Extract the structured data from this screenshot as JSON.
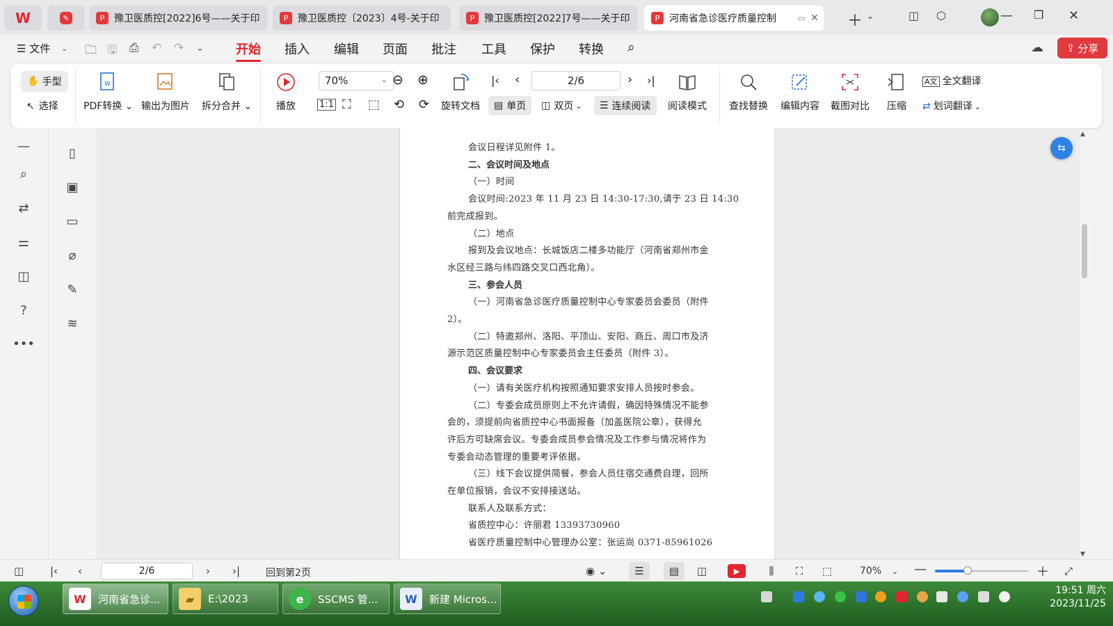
{
  "tabs": [
    {
      "title": "豫卫医质控[2022]6号——关于印",
      "active": false
    },
    {
      "title": "豫卫医质控〔2023〕4号-关于印",
      "active": false
    },
    {
      "title": "豫卫医质控[2022]7号——关于印",
      "active": false
    },
    {
      "title": "河南省急诊医疗质量控制",
      "active": true
    }
  ],
  "menubar": {
    "file": "☰ 文件",
    "items": [
      "开始",
      "插入",
      "编辑",
      "页面",
      "批注",
      "工具",
      "保护",
      "转换"
    ],
    "share": "分享"
  },
  "ribbon": {
    "hand": "手型",
    "select": "选择",
    "pdf_convert": "PDF转换",
    "export_image": "输出为图片",
    "split_merge": "拆分合并",
    "play": "播放",
    "zoom": "70%",
    "page": "2/6",
    "rotate_doc": "旋转文档",
    "single_page": "单页",
    "double_page": "双页",
    "continuous": "连续阅读",
    "read_mode": "阅读模式",
    "find_replace": "查找替换",
    "edit_content": "编辑内容",
    "screenshot_compare": "截图对比",
    "compress": "压缩",
    "full_translate": "全文翻译",
    "word_translate": "划词翻译"
  },
  "document": {
    "lines": [
      {
        "text": "会议日程详见附件 1。",
        "indent": true,
        "bold": false
      },
      {
        "text": "二、会议时间及地点",
        "indent": true,
        "bold": true
      },
      {
        "text": "（一）时间",
        "indent": true,
        "bold": false
      },
      {
        "text": "会议时间:2023 年 11 月 23 日 14:30-17:30,请于 23 日 14:30",
        "indent": true,
        "bold": false
      },
      {
        "text": "前完成报到。",
        "indent": false,
        "bold": false
      },
      {
        "text": "（二）地点",
        "indent": true,
        "bold": false
      },
      {
        "text": "报到及会议地点：长城饭店二楼多功能厅（河南省郑州市金",
        "indent": true,
        "bold": false
      },
      {
        "text": "水区经三路与纬四路交叉口西北角）。",
        "indent": false,
        "bold": false
      },
      {
        "text": "三、参会人员",
        "indent": true,
        "bold": true
      },
      {
        "text": "（一）河南省急诊医疗质量控制中心专家委员会委员（附件",
        "indent": true,
        "bold": false
      },
      {
        "text": "2）。",
        "indent": false,
        "bold": false
      },
      {
        "text": "（二）特邀郑州、洛阳、平顶山、安阳、商丘、周口市及济",
        "indent": true,
        "bold": false
      },
      {
        "text": "源示范区质量控制中心专家委员会主任委员（附件 3）。",
        "indent": false,
        "bold": false
      },
      {
        "text": "四、会议要求",
        "indent": true,
        "bold": true
      },
      {
        "text": "（一）请有关医疗机构按照通知要求安排人员按时参会。",
        "indent": true,
        "bold": false
      },
      {
        "text": "（二）专委会成员原则上不允许请假，确因特殊情况不能参",
        "indent": true,
        "bold": false
      },
      {
        "text": "会的，须提前向省质控中心书面报备（加盖医院公章），获得允",
        "indent": false,
        "bold": false
      },
      {
        "text": "许后方可缺席会议。专委会成员参会情况及工作参与情况将作为",
        "indent": false,
        "bold": false
      },
      {
        "text": "专委会动态管理的重要考评依据。",
        "indent": false,
        "bold": false
      },
      {
        "text": "（三）线下会议提供简餐，参会人员住宿交通费自理，回所",
        "indent": true,
        "bold": false
      },
      {
        "text": "在单位报销，会议不安排接送站。",
        "indent": false,
        "bold": false
      },
      {
        "text": "联系人及联系方式：",
        "indent": true,
        "bold": false
      },
      {
        "text": "省质控中心：许丽君 13393730960",
        "indent": true,
        "bold": false
      },
      {
        "text": "省医疗质量控制中心管理办公室：张运尚 0371-85961026",
        "indent": true,
        "bold": false
      }
    ]
  },
  "statusbar": {
    "page": "2/6",
    "goto": "回到第2页",
    "zoom": "70%",
    "zoom_level": 0.35
  },
  "taskbar": {
    "items": [
      {
        "label": "河南省急诊...",
        "active": true
      },
      {
        "label": "E:\\2023",
        "active": false
      },
      {
        "label": "SSCMS 管...",
        "active": false
      },
      {
        "label": "新建 Micros...",
        "active": false
      }
    ],
    "time": "19:51 周六",
    "date": "2023/11/25"
  },
  "colors": {
    "accent_red": "#e0262f",
    "taskbar_green": "#2f7a2f",
    "float_blue": "#2d82e6"
  }
}
